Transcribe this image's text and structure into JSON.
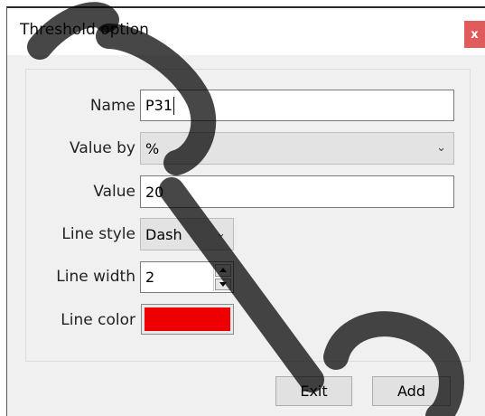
{
  "dialog": {
    "title": "Threshold option",
    "close_label": "x"
  },
  "form": {
    "name_label": "Name",
    "name_value": "P31",
    "value_by_label": "Value by",
    "value_by_value": "%",
    "value_label": "Value",
    "value_value": "20",
    "line_style_label": "Line style",
    "line_style_value": "Dash",
    "line_width_label": "Line width",
    "line_width_value": "2",
    "line_color_label": "Line color",
    "line_color_hex": "#ee0000"
  },
  "buttons": {
    "exit_label": "Exit",
    "add_label": "Add"
  },
  "icons": {
    "dropdown": "chevron-down-icon",
    "spin_up": "spin-up-icon",
    "spin_down": "spin-down-icon"
  }
}
